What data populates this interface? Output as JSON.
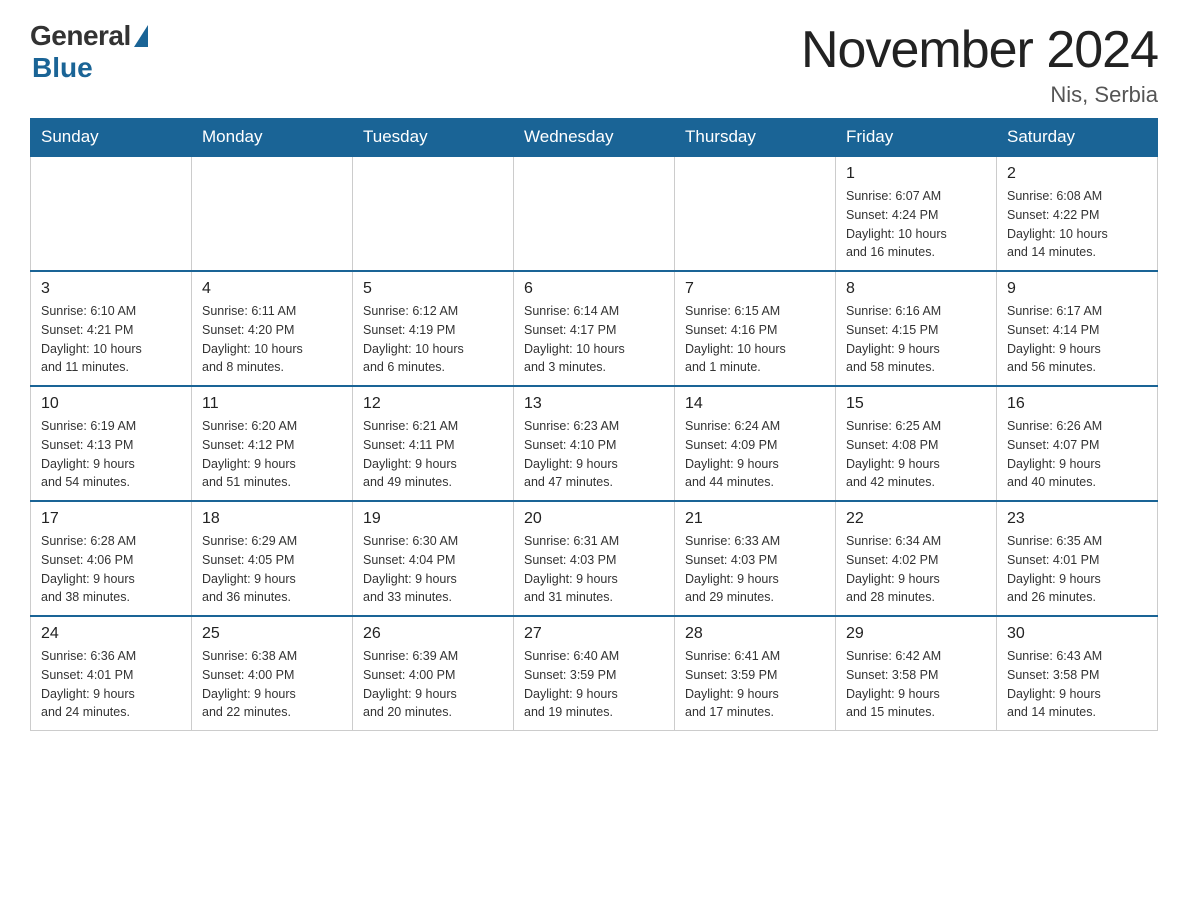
{
  "logo": {
    "general": "General",
    "blue": "Blue"
  },
  "title": "November 2024",
  "location": "Nis, Serbia",
  "days_of_week": [
    "Sunday",
    "Monday",
    "Tuesday",
    "Wednesday",
    "Thursday",
    "Friday",
    "Saturday"
  ],
  "weeks": [
    [
      {
        "day": "",
        "info": ""
      },
      {
        "day": "",
        "info": ""
      },
      {
        "day": "",
        "info": ""
      },
      {
        "day": "",
        "info": ""
      },
      {
        "day": "",
        "info": ""
      },
      {
        "day": "1",
        "info": "Sunrise: 6:07 AM\nSunset: 4:24 PM\nDaylight: 10 hours\nand 16 minutes."
      },
      {
        "day": "2",
        "info": "Sunrise: 6:08 AM\nSunset: 4:22 PM\nDaylight: 10 hours\nand 14 minutes."
      }
    ],
    [
      {
        "day": "3",
        "info": "Sunrise: 6:10 AM\nSunset: 4:21 PM\nDaylight: 10 hours\nand 11 minutes."
      },
      {
        "day": "4",
        "info": "Sunrise: 6:11 AM\nSunset: 4:20 PM\nDaylight: 10 hours\nand 8 minutes."
      },
      {
        "day": "5",
        "info": "Sunrise: 6:12 AM\nSunset: 4:19 PM\nDaylight: 10 hours\nand 6 minutes."
      },
      {
        "day": "6",
        "info": "Sunrise: 6:14 AM\nSunset: 4:17 PM\nDaylight: 10 hours\nand 3 minutes."
      },
      {
        "day": "7",
        "info": "Sunrise: 6:15 AM\nSunset: 4:16 PM\nDaylight: 10 hours\nand 1 minute."
      },
      {
        "day": "8",
        "info": "Sunrise: 6:16 AM\nSunset: 4:15 PM\nDaylight: 9 hours\nand 58 minutes."
      },
      {
        "day": "9",
        "info": "Sunrise: 6:17 AM\nSunset: 4:14 PM\nDaylight: 9 hours\nand 56 minutes."
      }
    ],
    [
      {
        "day": "10",
        "info": "Sunrise: 6:19 AM\nSunset: 4:13 PM\nDaylight: 9 hours\nand 54 minutes."
      },
      {
        "day": "11",
        "info": "Sunrise: 6:20 AM\nSunset: 4:12 PM\nDaylight: 9 hours\nand 51 minutes."
      },
      {
        "day": "12",
        "info": "Sunrise: 6:21 AM\nSunset: 4:11 PM\nDaylight: 9 hours\nand 49 minutes."
      },
      {
        "day": "13",
        "info": "Sunrise: 6:23 AM\nSunset: 4:10 PM\nDaylight: 9 hours\nand 47 minutes."
      },
      {
        "day": "14",
        "info": "Sunrise: 6:24 AM\nSunset: 4:09 PM\nDaylight: 9 hours\nand 44 minutes."
      },
      {
        "day": "15",
        "info": "Sunrise: 6:25 AM\nSunset: 4:08 PM\nDaylight: 9 hours\nand 42 minutes."
      },
      {
        "day": "16",
        "info": "Sunrise: 6:26 AM\nSunset: 4:07 PM\nDaylight: 9 hours\nand 40 minutes."
      }
    ],
    [
      {
        "day": "17",
        "info": "Sunrise: 6:28 AM\nSunset: 4:06 PM\nDaylight: 9 hours\nand 38 minutes."
      },
      {
        "day": "18",
        "info": "Sunrise: 6:29 AM\nSunset: 4:05 PM\nDaylight: 9 hours\nand 36 minutes."
      },
      {
        "day": "19",
        "info": "Sunrise: 6:30 AM\nSunset: 4:04 PM\nDaylight: 9 hours\nand 33 minutes."
      },
      {
        "day": "20",
        "info": "Sunrise: 6:31 AM\nSunset: 4:03 PM\nDaylight: 9 hours\nand 31 minutes."
      },
      {
        "day": "21",
        "info": "Sunrise: 6:33 AM\nSunset: 4:03 PM\nDaylight: 9 hours\nand 29 minutes."
      },
      {
        "day": "22",
        "info": "Sunrise: 6:34 AM\nSunset: 4:02 PM\nDaylight: 9 hours\nand 28 minutes."
      },
      {
        "day": "23",
        "info": "Sunrise: 6:35 AM\nSunset: 4:01 PM\nDaylight: 9 hours\nand 26 minutes."
      }
    ],
    [
      {
        "day": "24",
        "info": "Sunrise: 6:36 AM\nSunset: 4:01 PM\nDaylight: 9 hours\nand 24 minutes."
      },
      {
        "day": "25",
        "info": "Sunrise: 6:38 AM\nSunset: 4:00 PM\nDaylight: 9 hours\nand 22 minutes."
      },
      {
        "day": "26",
        "info": "Sunrise: 6:39 AM\nSunset: 4:00 PM\nDaylight: 9 hours\nand 20 minutes."
      },
      {
        "day": "27",
        "info": "Sunrise: 6:40 AM\nSunset: 3:59 PM\nDaylight: 9 hours\nand 19 minutes."
      },
      {
        "day": "28",
        "info": "Sunrise: 6:41 AM\nSunset: 3:59 PM\nDaylight: 9 hours\nand 17 minutes."
      },
      {
        "day": "29",
        "info": "Sunrise: 6:42 AM\nSunset: 3:58 PM\nDaylight: 9 hours\nand 15 minutes."
      },
      {
        "day": "30",
        "info": "Sunrise: 6:43 AM\nSunset: 3:58 PM\nDaylight: 9 hours\nand 14 minutes."
      }
    ]
  ]
}
